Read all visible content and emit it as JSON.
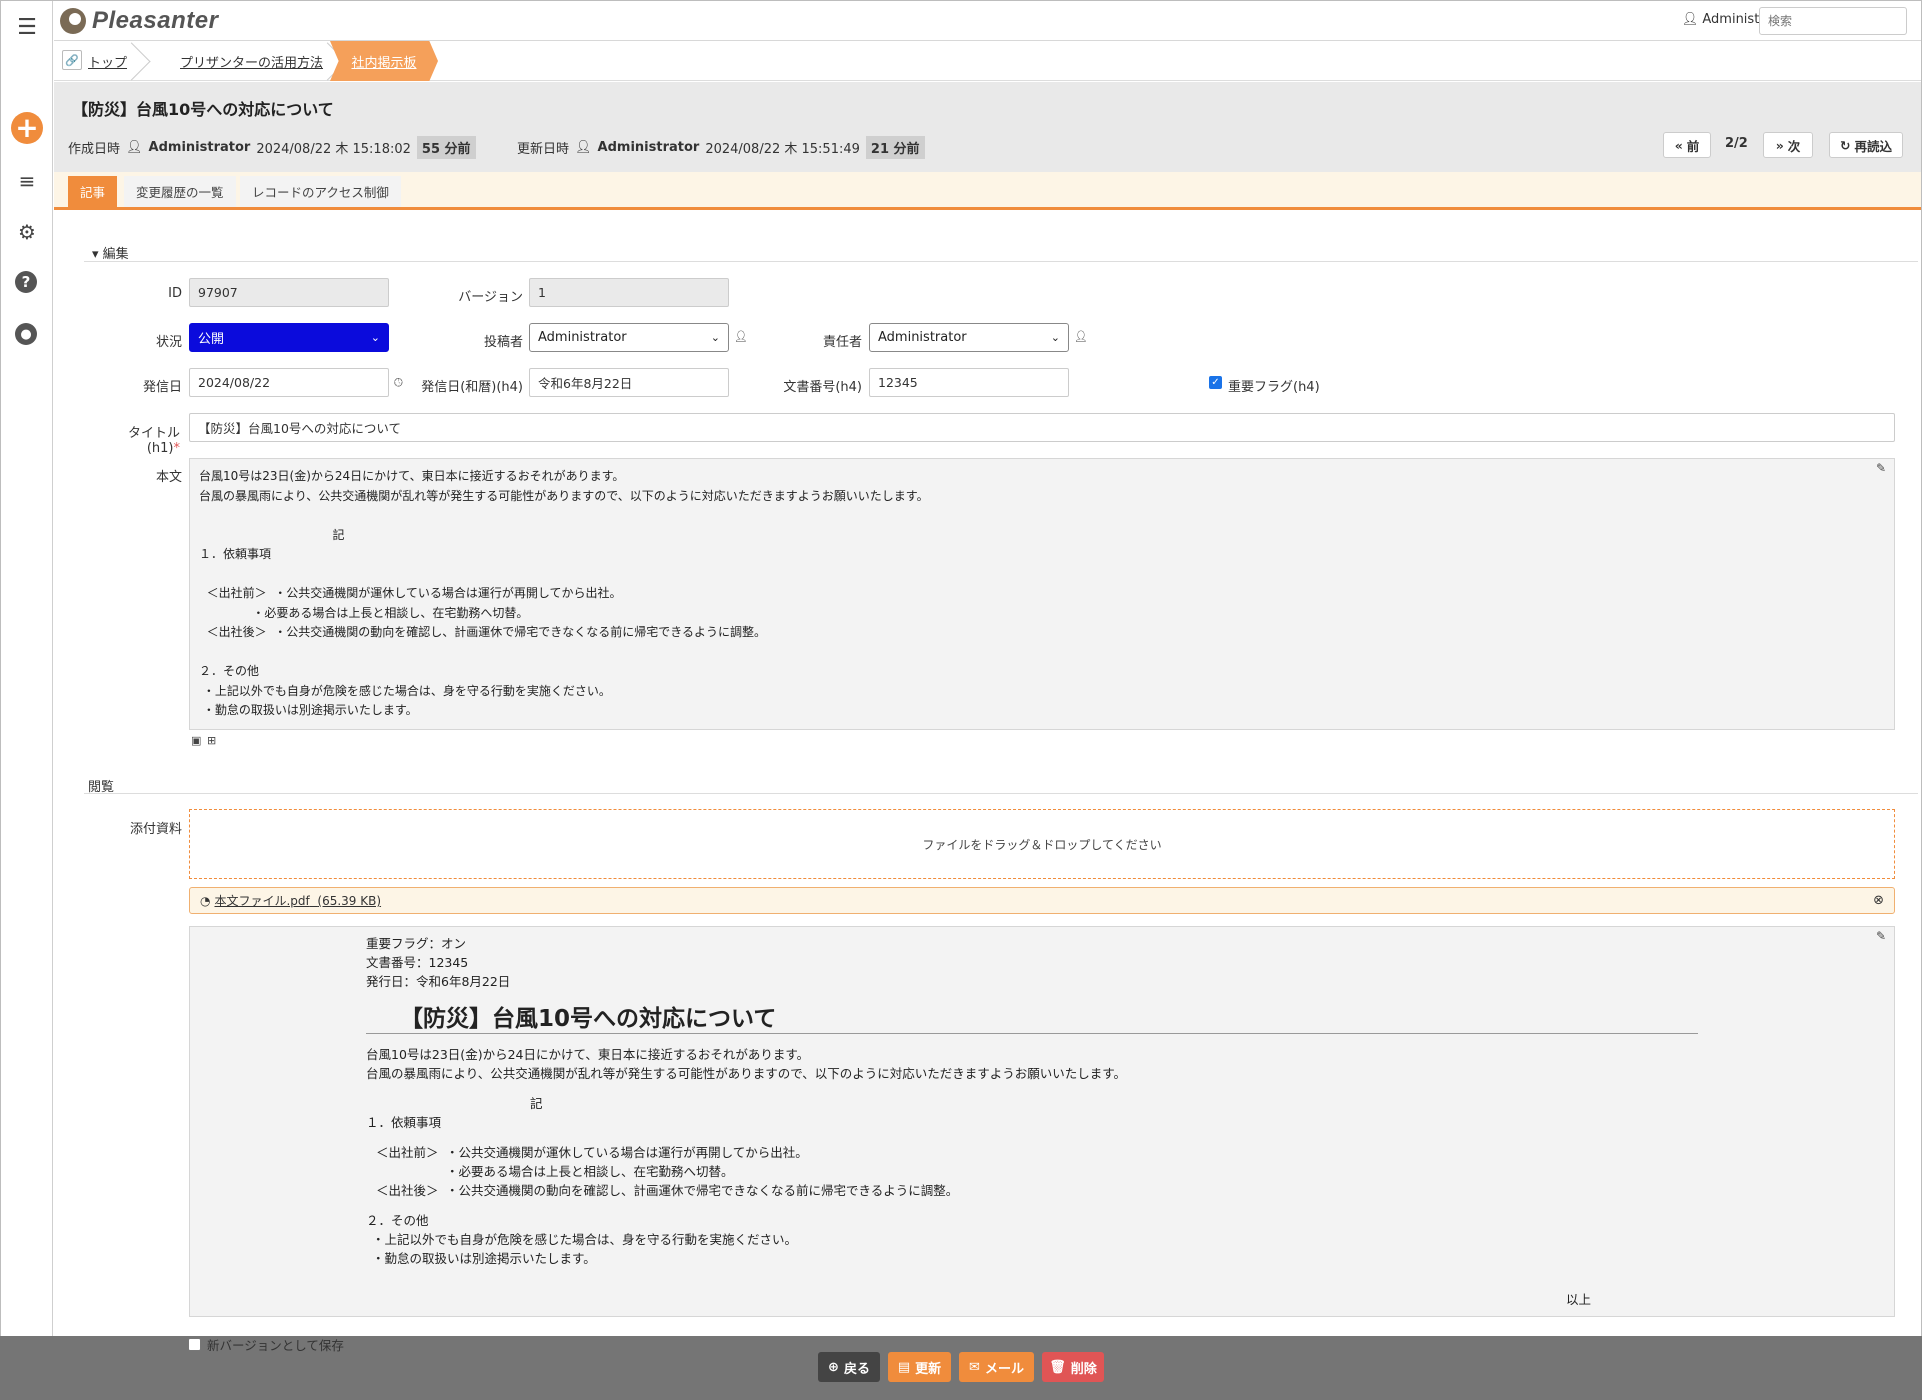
{
  "brand": {
    "name": "Pleasanter"
  },
  "header": {
    "user": "Administrator",
    "search_placeholder": "検索"
  },
  "breadcrumb": {
    "items": [
      "トップ",
      "プリザンターの活用方法"
    ],
    "active": "社内掲示板"
  },
  "record": {
    "title": "【防災】台風10号への対応について",
    "created_label": "作成日時",
    "created_by": "Administrator",
    "created_at": "2024/08/22 木 15:18:02",
    "created_ago": "55 分前",
    "updated_label": "更新日時",
    "updated_by": "Administrator",
    "updated_at": "2024/08/22 木 15:51:49",
    "updated_ago": "21 分前",
    "prev": "前",
    "next": "次",
    "page": "2/2",
    "reload": "再読込"
  },
  "tabs": [
    "記事",
    "変更履歴の一覧",
    "レコードのアクセス制御"
  ],
  "sections": {
    "edit": "編集",
    "view": "閲覧"
  },
  "fields": {
    "id_label": "ID",
    "id_value": "97907",
    "version_label": "バージョン",
    "version_value": "1",
    "status_label": "状況",
    "status_value": "公開",
    "poster_label": "投稿者",
    "poster_value": "Administrator",
    "owner_label": "責任者",
    "owner_value": "Administrator",
    "date_label": "発信日",
    "date_value": "2024/08/22",
    "wareki_label": "発信日(和暦)(h4)",
    "wareki_value": "令和6年8月22日",
    "docno_label": "文書番号(h4)",
    "docno_value": "12345",
    "flag_label": "重要フラグ(h4)",
    "flag_checked": true,
    "title_label": "タイトル(h1)",
    "title_required": "*",
    "title_value": "【防災】台風10号への対応について",
    "body_label": "本文",
    "body_text": "台風10号は23日(金)から24日にかけて、東日本に接近するおそれがあります。\n台風の暴風雨により、公共交通機関が乱れ等が発生する可能性がありますので、以下のように対応いただきますようお願いいたします。\n\n                                   記\n１．依頼事項\n\n  ＜出社前＞  ・公共交通機関が運休している場合は運行が再開してから出社。\n              ・必要ある場合は上長と相談し、在宅勤務へ切替。\n  ＜出社後＞  ・公共交通機関の動向を確認し、計画運休で帰宅できなくなる前に帰宅できるように調整。\n\n２．その他\n ・上記以外でも自身が危険を感じた場合は、身を守る行動を実施ください。\n ・勤怠の取扱いは別途掲示いたします。",
    "attach_label": "添付資料",
    "dropzone": "ファイルをドラッグ＆ドロップしてください",
    "attachment_name": "本文ファイル.pdf",
    "attachment_size": "(65.39 KB)"
  },
  "preview": {
    "flag": "重要フラグ：オン",
    "docno": "文書番号：12345",
    "date": "発行日：令和6年8月22日",
    "heading": "【防災】台風10号への対応について",
    "p1": "台風10号は23日(金)から24日にかけて、東日本に接近するおそれがあります。",
    "p2": "台風の暴風雨により、公共交通機関が乱れ等が発生する可能性がありますので、以下のように対応いただきますようお願いいたします。",
    "ki": "記",
    "s1": "１．依頼事項",
    "b1a": "＜出社前＞",
    "b1": "・公共交通機関が運休している場合は運行が再開してから出社。",
    "b2": "・必要ある場合は上長と相談し、在宅勤務へ切替。",
    "b3a": "＜出社後＞",
    "b3": "・公共交通機関の動向を確認し、計画運休で帰宅できなくなる前に帰宅できるように調整。",
    "s2": "２．その他",
    "o1": "・上記以外でも自身が危険を感じた場合は、身を守る行動を実施ください。",
    "o2": "・勤怠の取扱いは別途掲示いたします。",
    "end": "以上"
  },
  "footer": {
    "new_version": "新バージョンとして保存",
    "back": "戻る",
    "update": "更新",
    "mail": "メール",
    "delete": "削除"
  },
  "colors": {
    "accent": "#f08c3c",
    "status_bg": "#0b0bdc",
    "footer_bg": "#757575",
    "delete": "#e05555",
    "back": "#444444"
  },
  "icons": [
    "menu-icon",
    "add-icon",
    "sort-icon",
    "gear-icon",
    "help-icon",
    "user-icon",
    "pencil-icon",
    "clock-icon",
    "image-icon",
    "table-icon",
    "close-icon"
  ]
}
